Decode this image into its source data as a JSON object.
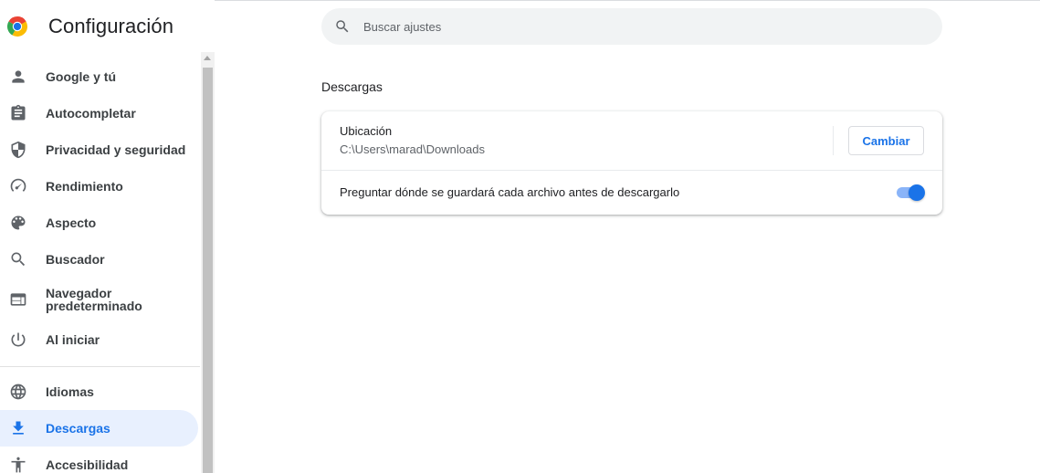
{
  "header": {
    "title": "Configuración",
    "logo_icon": "chrome-logo-icon"
  },
  "search": {
    "placeholder": "Buscar ajustes",
    "value": ""
  },
  "sidebar": {
    "items": [
      {
        "label": "Google y tú",
        "icon": "person-icon"
      },
      {
        "label": "Autocompletar",
        "icon": "clipboard-icon"
      },
      {
        "label": "Privacidad y seguridad",
        "icon": "shield-icon"
      },
      {
        "label": "Rendimiento",
        "icon": "speedometer-icon"
      },
      {
        "label": "Aspecto",
        "icon": "palette-icon"
      },
      {
        "label": "Buscador",
        "icon": "search-icon"
      },
      {
        "label": "Navegador predeterminado",
        "icon": "browser-window-icon"
      },
      {
        "label": "Al iniciar",
        "icon": "power-icon"
      },
      {
        "label": "Idiomas",
        "icon": "globe-icon"
      },
      {
        "label": "Descargas",
        "icon": "download-icon",
        "active": true
      },
      {
        "label": "Accesibilidad",
        "icon": "accessibility-icon"
      }
    ]
  },
  "main": {
    "section_title": "Descargas",
    "location": {
      "label": "Ubicación",
      "path": "C:\\Users\\marad\\Downloads",
      "button_label": "Cambiar"
    },
    "ask_where": {
      "label": "Preguntar dónde se guardará cada archivo antes de descargarlo",
      "enabled": true
    }
  },
  "colors": {
    "accent": "#1a73e8",
    "active_bg": "#e8f0fe",
    "toggle_track": "#8ab4f8"
  }
}
